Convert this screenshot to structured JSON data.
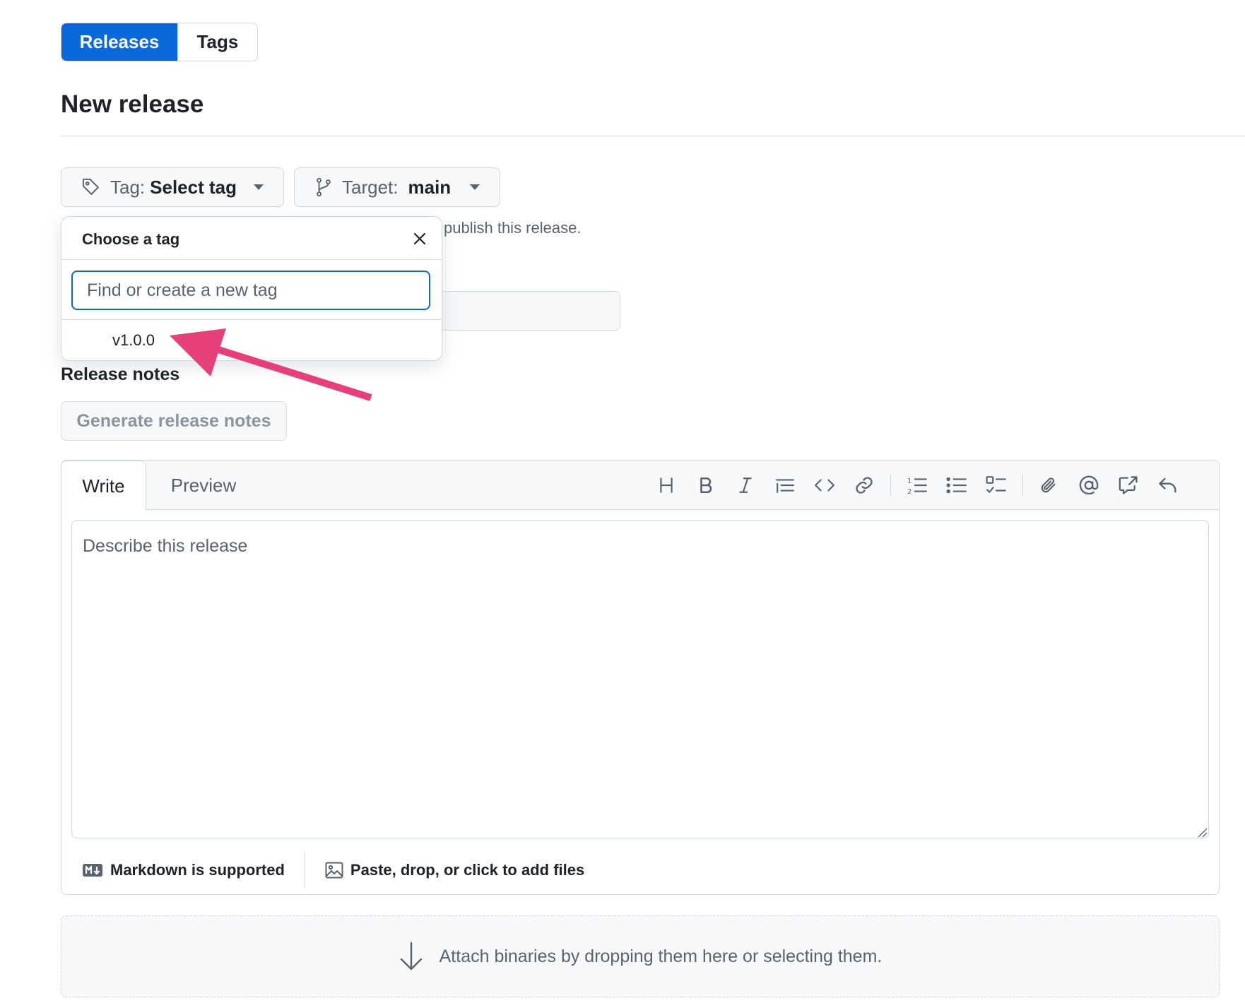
{
  "tabs": {
    "releases": "Releases",
    "tags": "Tags"
  },
  "page": {
    "title": "New release"
  },
  "tag_picker": {
    "label": "Tag:",
    "value": "Select tag",
    "icon": "tag-icon"
  },
  "target_picker": {
    "label": "Target:",
    "value": "main",
    "icon": "git-branch-icon"
  },
  "hint_text": "publish this release.",
  "dropdown": {
    "title": "Choose a tag",
    "search_placeholder": "Find or create a new tag",
    "items": [
      "v1.0.0"
    ]
  },
  "release_notes": {
    "label": "Release notes",
    "generate_button": "Generate release notes"
  },
  "editor": {
    "tab_write": "Write",
    "tab_preview": "Preview",
    "placeholder": "Describe this release",
    "toolbar_icons": [
      "heading-icon",
      "bold-icon",
      "italic-icon",
      "quote-icon",
      "code-icon",
      "link-icon",
      "ordered-list-icon",
      "unordered-list-icon",
      "task-list-icon",
      "attach-icon",
      "mention-icon",
      "cross-reference-icon",
      "reply-icon"
    ],
    "footer_markdown": "Markdown is supported",
    "footer_files": "Paste, drop, or click to add files"
  },
  "attach": {
    "text": "Attach binaries by dropping them here or selecting them."
  },
  "colors": {
    "accent": "#0969da",
    "annotation_arrow": "#e5407a",
    "muted_text": "#59636e",
    "border": "#d0d7de"
  }
}
